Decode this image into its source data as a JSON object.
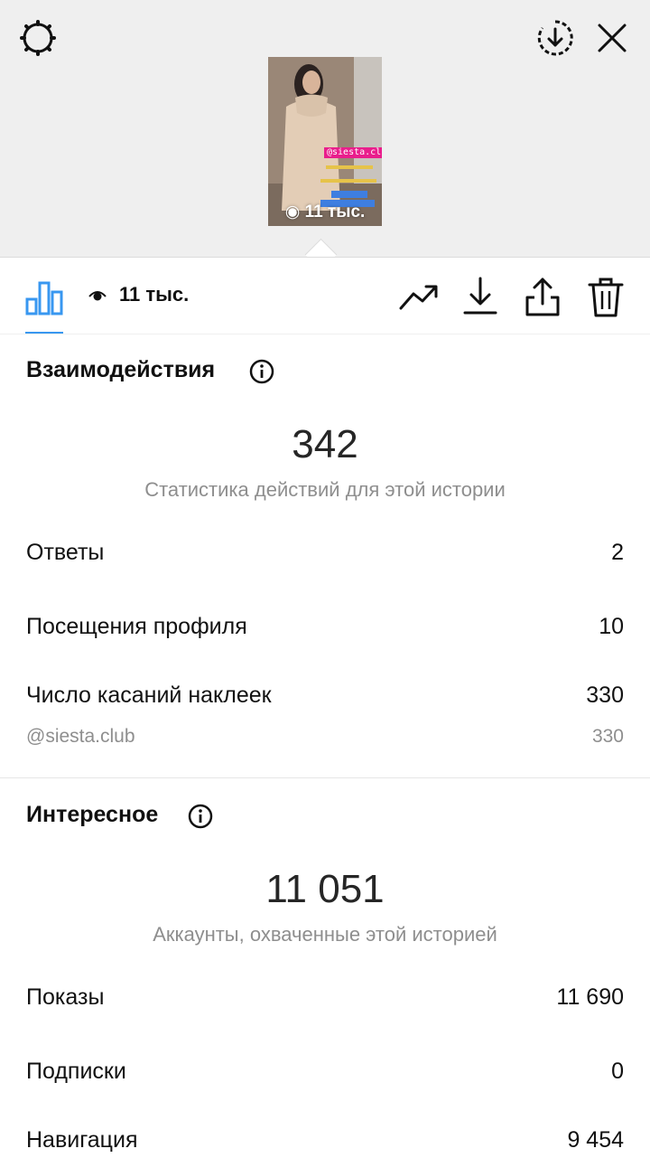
{
  "story_preview": {
    "sticker_text": "@siesta.club",
    "views_label": "11 тыс."
  },
  "toolbar": {
    "views_label": "11 тыс."
  },
  "interactions": {
    "title": "Взаимодействия",
    "total": "342",
    "caption": "Статистика действий для этой истории",
    "rows": [
      {
        "label": "Ответы",
        "value": "2"
      },
      {
        "label": "Посещения профиля",
        "value": "10"
      },
      {
        "label": "Число касаний наклеек",
        "value": "330"
      }
    ],
    "sub_row": {
      "label": "@siesta.club",
      "value": "330"
    }
  },
  "discovery": {
    "title": "Интересное",
    "total": "11 051",
    "caption": "Аккаунты, охваченные этой историей",
    "rows": [
      {
        "label": "Показы",
        "value": "11 690"
      },
      {
        "label": "Подписки",
        "value": "0"
      },
      {
        "label": "Навигация",
        "value": "9 454"
      }
    ]
  },
  "colors": {
    "accent": "#3897f0",
    "header_bg": "#efefef",
    "muted_text": "#8e8e8e"
  },
  "icons": [
    "settings-gear-icon",
    "download-circle-icon",
    "close-icon",
    "bar-chart-icon",
    "eye-icon",
    "trending-icon",
    "download-icon",
    "share-icon",
    "trash-icon",
    "info-icon"
  ]
}
